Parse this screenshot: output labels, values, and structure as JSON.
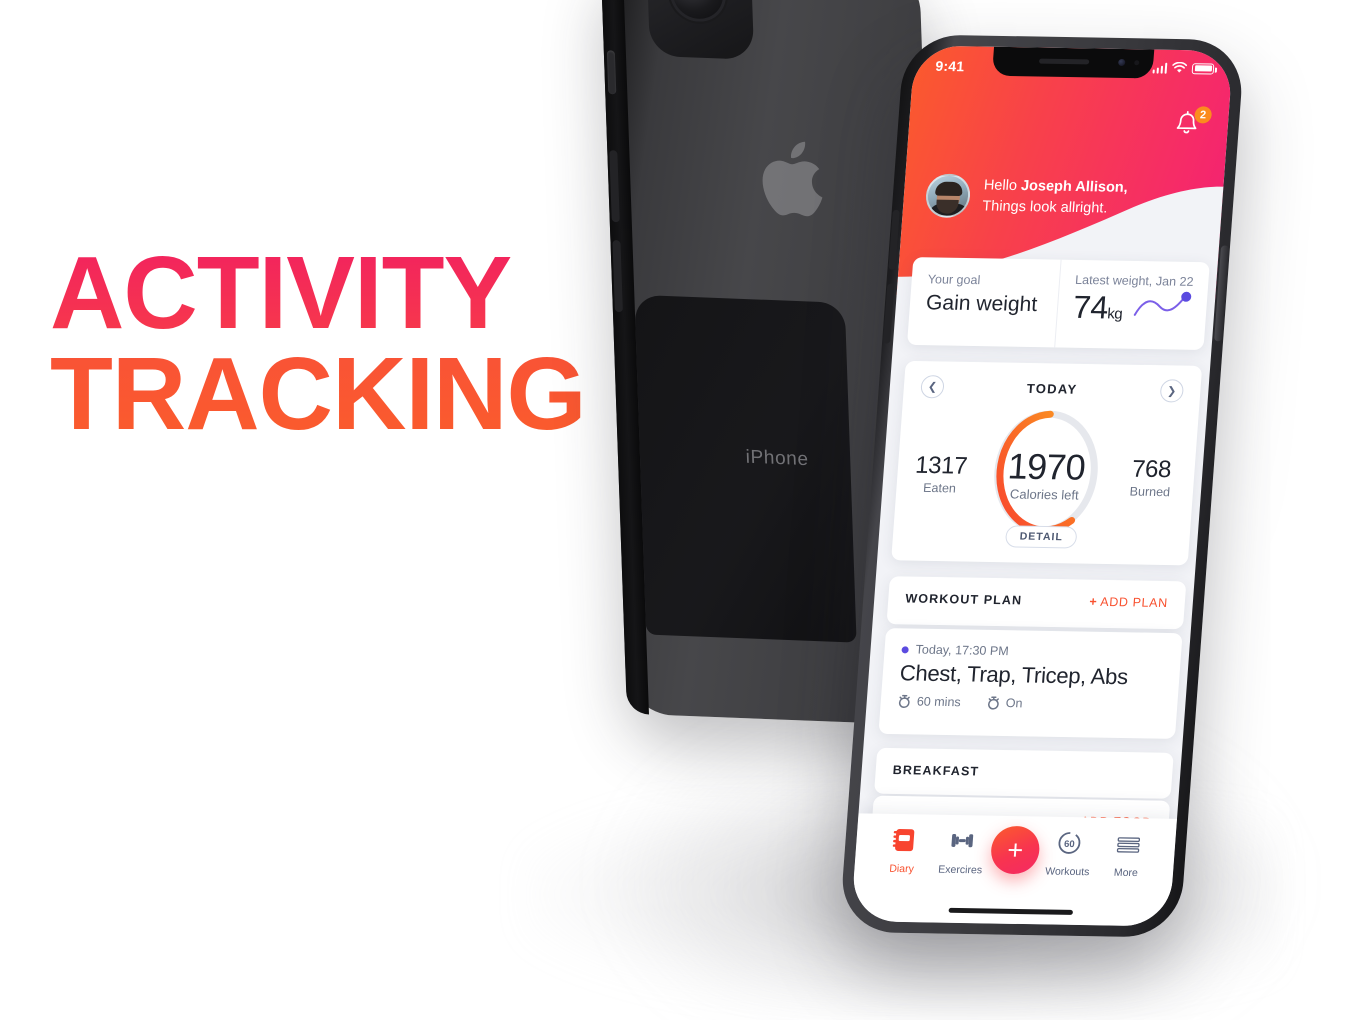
{
  "poster": {
    "headline_line1": "ACTIVITY",
    "headline_line2": "TRACKING",
    "color_pink": "#f2225f",
    "color_orange": "#fa5c2c",
    "background": "#ffffff"
  },
  "back_phone": {
    "engraved_label": "iPhone",
    "body_color": "#3f3f42",
    "logo": "apple-logo"
  },
  "app": {
    "status_bar": {
      "time": "9:41",
      "signal_icon": "cellular-signal-icon",
      "wifi_icon": "wifi-icon",
      "battery_icon": "battery-icon"
    },
    "header": {
      "notifications_icon": "bell-icon",
      "notifications_count": "2",
      "badge_color": "#fb8b1e",
      "greeting_prefix": "Hello ",
      "user_name": "Joseph Allison,",
      "greeting_subtitle": "Things look allright.",
      "gradient_from": "#fb5a2d",
      "gradient_to": "#f32074"
    },
    "goal_card": {
      "goal_label": "Your goal",
      "goal_value": "Gain weight",
      "weight_label": "Latest weight, Jan 22",
      "weight_value": "74",
      "weight_unit": "kg",
      "sparkline_color": "#5b4be0"
    },
    "today_card": {
      "title": "TODAY",
      "prev_icon": "chevron-left-icon",
      "next_icon": "chevron-right-icon",
      "calories_left": "1970",
      "calories_left_label": "Calories left",
      "eaten_value": "1317",
      "eaten_label": "Eaten",
      "burned_value": "768",
      "burned_label": "Burned",
      "detail_button": "DETAIL",
      "ring_from": "#f8512f",
      "ring_to": "#fb9a22",
      "ring_track": "#e6e8ed"
    },
    "workout_plan": {
      "section_title": "WORKOUT PLAN",
      "add_plus": "+",
      "add_label": "ADD PLAN",
      "when": "Today, 17:30 PM",
      "dot_color": "#5b4be0",
      "title": "Chest, Trap, Tricep, Abs",
      "duration_icon": "stopwatch-icon",
      "duration": "60 mins",
      "alarm_icon": "alarm-icon",
      "alarm_state": "On"
    },
    "breakfast": {
      "section_title": "BREAKFAST",
      "add_plus": "+",
      "add_label": "ADD FOOD"
    },
    "tabbar": {
      "items": [
        {
          "label": "Diary",
          "icon": "notebook-icon",
          "active": true
        },
        {
          "label": "Exercires",
          "icon": "dumbbell-icon",
          "active": false
        },
        {
          "label": "Workouts",
          "icon": "timer-60-icon",
          "active": false
        },
        {
          "label": "More",
          "icon": "menu-lines-icon",
          "active": false
        }
      ],
      "fab_icon": "plus-icon",
      "fab_label": "+",
      "active_color": "#f8512f",
      "inactive_color": "#5a6580",
      "timer_icon_text": "60"
    }
  }
}
